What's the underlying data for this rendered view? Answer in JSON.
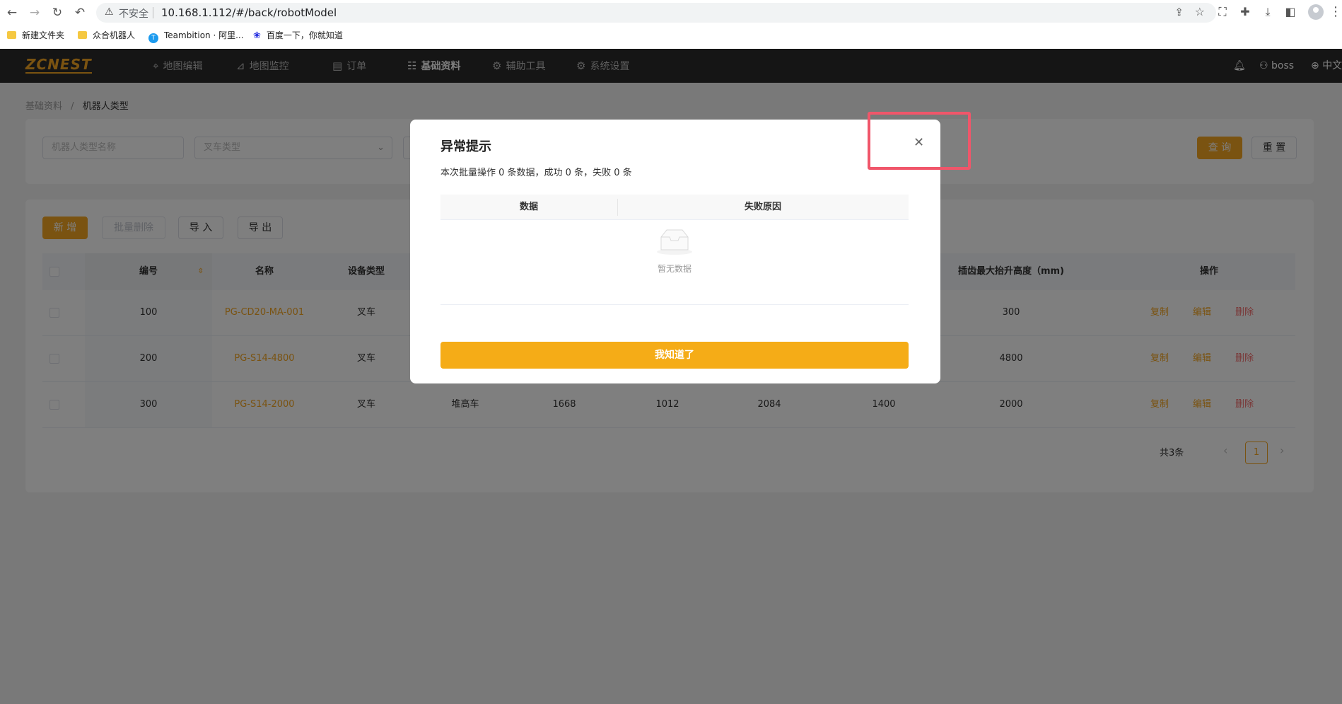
{
  "browser": {
    "insecure_label": "不安全",
    "url": "10.168.1.112/#/back/robotModel",
    "bookmarks": [
      "新建文件夹",
      "众合机器人",
      "Teambition · 阿里...",
      "百度一下，你就知道"
    ]
  },
  "header": {
    "logo": "ZCNEST",
    "nav": [
      "地图编辑",
      "地图监控",
      "订单",
      "基础资料",
      "辅助工具",
      "系统设置"
    ],
    "active_nav": "基础资料",
    "user": "boss",
    "lang": "中文"
  },
  "breadcrumb": {
    "parent": "基础资料",
    "separator": "/",
    "current": "机器人类型"
  },
  "search": {
    "name_placeholder": "机器人类型名称",
    "forklift_placeholder": "叉车类型",
    "query_label": "查 询",
    "reset_label": "重 置"
  },
  "toolbar": {
    "add": "新 增",
    "batch_delete": "批量删除",
    "import": "导 入",
    "export": "导 出"
  },
  "table": {
    "headers": {
      "no": "编号",
      "name": "名称",
      "device_type": "设备类型",
      "max_lift": "插齿最大抬升高度（mm)",
      "actions": "操作"
    },
    "rows": [
      {
        "no": "100",
        "name": "PG-CD20-MA-001",
        "device": "叉车",
        "c4": "",
        "c5": "",
        "c6": "",
        "c7": "",
        "c8": "",
        "max_lift": "300"
      },
      {
        "no": "200",
        "name": "PG-S14-4800",
        "device": "叉车",
        "c4": "",
        "c5": "",
        "c6": "",
        "c7": "",
        "c8": "",
        "max_lift": "4800"
      },
      {
        "no": "300",
        "name": "PG-S14-2000",
        "device": "叉车",
        "c4": "堆高车",
        "c5": "1668",
        "c6": "1012",
        "c7": "2084",
        "c8": "1400",
        "max_lift": "2000"
      }
    ],
    "action_labels": {
      "copy": "复制",
      "edit": "编辑",
      "delete": "删除"
    }
  },
  "pagination": {
    "total": "共3条",
    "current": "1"
  },
  "modal": {
    "title": "异常提示",
    "message": "本次批量操作 0 条数据，成功 0 条，失败 0 条",
    "col_data": "数据",
    "col_reason": "失败原因",
    "empty": "暂无数据",
    "ok": "我知道了"
  }
}
